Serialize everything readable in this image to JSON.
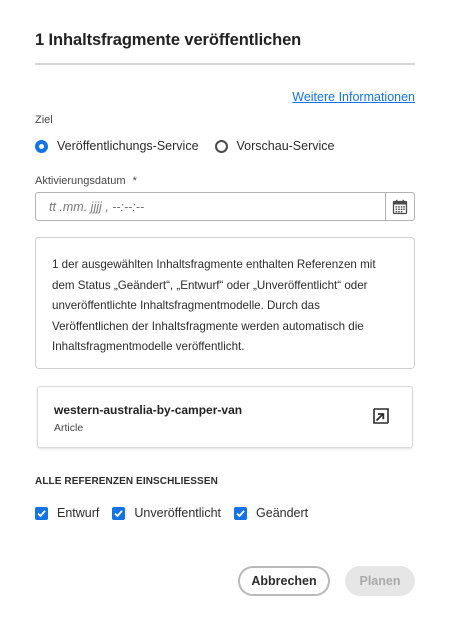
{
  "dialog": {
    "title": "1 Inhaltsfragmente veröffentlichen",
    "more_info_link": "Weitere Informationen"
  },
  "target": {
    "label": "Ziel",
    "options": [
      {
        "label": "Veröffentlichungs-Service",
        "checked": true
      },
      {
        "label": "Vorschau-Service",
        "checked": false
      }
    ]
  },
  "activation_date": {
    "label": "Aktivierungsdatum",
    "required_marker": "*",
    "placeholder": "tt .mm.  jjjj  , --:--:--"
  },
  "info_message": "1 der ausgewählten Inhaltsfragmente enthalten Referenzen mit dem Status „Geändert“, „Entwurf“ oder „Unveröffentlicht“ oder unveröffentlichte Inhaltsfragmentmodelle. Durch das Veröffentlichen der Inhaltsfragmente werden automatisch die Inhaltsfragmentmodelle veröffentlicht.",
  "fragment_card": {
    "title": "western-australia-by-camper-van",
    "subtitle": "Article",
    "icon": "open-in-icon"
  },
  "references": {
    "label": "ALLE REFERENZEN EINSCHLIESSEN",
    "options": [
      {
        "label": "Entwurf",
        "checked": true
      },
      {
        "label": "Unveröffentlicht",
        "checked": true
      },
      {
        "label": "Geändert",
        "checked": true
      }
    ]
  },
  "buttons": {
    "cancel": "Abbrechen",
    "schedule": "Planen"
  },
  "colors": {
    "accent": "#1473e6",
    "disabled_bg": "#e6e6e6",
    "disabled_text": "#a9a9a9"
  }
}
